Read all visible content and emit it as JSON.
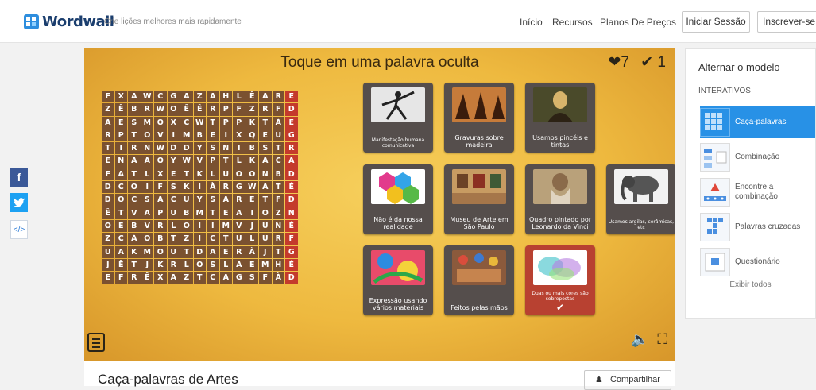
{
  "brand": {
    "name": "Wordwall",
    "tagline": "Crie lições melhores mais rapidamente"
  },
  "nav": {
    "inicio": "Início",
    "recursos": "Recursos",
    "planos": "Planos De Preços",
    "login": "Iniciar Sessão",
    "signup": "Inscrever-se"
  },
  "social": {
    "facebook": "f",
    "embed": "</>"
  },
  "activity": {
    "title": "Toque em uma palavra oculta",
    "lives": "7",
    "found": "1",
    "grid": [
      "FXAWCGAZAHLÊARE",
      "ZÊBRWOÊÊRPFZRFD",
      "AESMOXCWTPPKTÀE",
      "RPTOVIMBEIXQEUG",
      "TIRNWDDYSNIBSTR",
      "ENAAOYWVPTLKACA",
      "FATLXETKLUOONBD",
      "DCOIFSKIÀRGWATÉ",
      "DOCSÁCUYSARETFD",
      "ÊTVAPUBMTEAIOZN",
      "OEBVRLOIIMVJUNÉ",
      "ZCÀOBTZICTULURF",
      "UAKMOUTDAERÀJTG",
      "JÊTJKRLOSLAEMHÉ",
      "EFRÊXAZTCAGSFÀD"
    ],
    "cards": [
      {
        "caption": "Manifestação humana comunicativa"
      },
      {
        "caption": "Gravuras sobre madeira"
      },
      {
        "caption": "Usamos pincéis e tintas"
      },
      {
        "caption": "Não é da nossa realidade"
      },
      {
        "caption": "Museu de Arte em São Paulo"
      },
      {
        "caption": "Quadro pintado por Leonardo da Vinci"
      },
      {
        "caption": "Usamos argilas, cerâmicas, etc"
      },
      {
        "caption": "Expressão usando vários materiais"
      },
      {
        "caption": "Feitos pelas mãos"
      },
      {
        "caption": "Duas ou mais cores são sobrepostas"
      }
    ]
  },
  "sidebar": {
    "title": "Alternar o modelo",
    "section": "INTERATIVOS",
    "items": [
      "Caça-palavras",
      "Combinação",
      "Encontre a combinação",
      "Palavras cruzadas",
      "Questionário"
    ],
    "show_all": "Exibir todos"
  },
  "page": {
    "title": "Caça-palavras de Artes",
    "share": "Compartilhar"
  },
  "colors": {
    "accent": "#2891e6",
    "grid_cell": "#7a5130",
    "grid_last_col": "#c43a2c",
    "card": "#554e4c",
    "card_found": "#b84131"
  }
}
